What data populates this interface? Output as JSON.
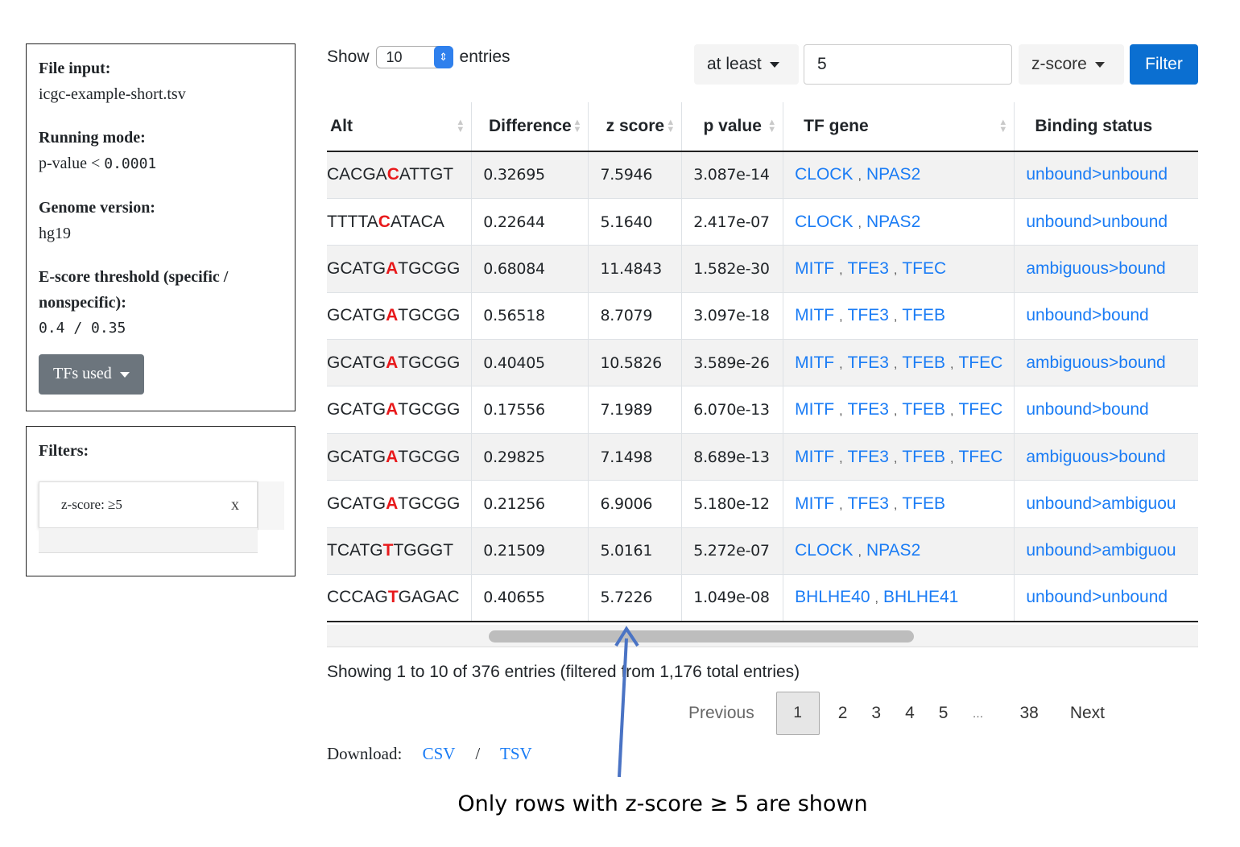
{
  "info": {
    "file_label": "File input:",
    "file_value": "icgc-example-short.tsv",
    "mode_label": "Running mode:",
    "mode_value_prefix": "p-value < ",
    "mode_value_num": "0.0001",
    "genome_label": "Genome version:",
    "genome_value": "hg19",
    "escore_label": "E-score threshold (specific / nonspecific):",
    "escore_value": "0.4 / 0.35",
    "tfs_button": "TFs used"
  },
  "filters": {
    "title": "Filters:",
    "chip_label": "z-score: ≥5",
    "chip_close": "x"
  },
  "controls": {
    "show_label": "Show",
    "entries_label": "entries",
    "length_value": "10",
    "comparator": "at least",
    "threshold_value": "5",
    "column": "z-score",
    "filter_button": "Filter"
  },
  "table": {
    "headers": [
      "Alt",
      "Difference",
      "z score",
      "p value",
      "TF gene",
      "Binding status"
    ],
    "rows": [
      {
        "alt_pre": "CACGA",
        "alt_mut": "C",
        "alt_post": "ATTGT",
        "diff": "0.32695",
        "z": "7.5946",
        "p": "3.087e-14",
        "genes": [
          "CLOCK",
          "NPAS2"
        ],
        "status": "unbound>unbound"
      },
      {
        "alt_pre": "TTTTA",
        "alt_mut": "C",
        "alt_post": "ATACA",
        "diff": "0.22644",
        "z": "5.1640",
        "p": "2.417e-07",
        "genes": [
          "CLOCK",
          "NPAS2"
        ],
        "status": "unbound>unbound"
      },
      {
        "alt_pre": "GCATG",
        "alt_mut": "A",
        "alt_post": "TGCGG",
        "diff": "0.68084",
        "z": "11.4843",
        "p": "1.582e-30",
        "genes": [
          "MITF",
          "TFE3",
          "TFEC"
        ],
        "status": "ambiguous>bound"
      },
      {
        "alt_pre": "GCATG",
        "alt_mut": "A",
        "alt_post": "TGCGG",
        "diff": "0.56518",
        "z": "8.7079",
        "p": "3.097e-18",
        "genes": [
          "MITF",
          "TFE3",
          "TFEB"
        ],
        "status": "unbound>bound"
      },
      {
        "alt_pre": "GCATG",
        "alt_mut": "A",
        "alt_post": "TGCGG",
        "diff": "0.40405",
        "z": "10.5826",
        "p": "3.589e-26",
        "genes": [
          "MITF",
          "TFE3",
          "TFEB",
          "TFEC"
        ],
        "status": "ambiguous>bound"
      },
      {
        "alt_pre": "GCATG",
        "alt_mut": "A",
        "alt_post": "TGCGG",
        "diff": "0.17556",
        "z": "7.1989",
        "p": "6.070e-13",
        "genes": [
          "MITF",
          "TFE3",
          "TFEB",
          "TFEC"
        ],
        "status": "unbound>bound"
      },
      {
        "alt_pre": "GCATG",
        "alt_mut": "A",
        "alt_post": "TGCGG",
        "diff": "0.29825",
        "z": "7.1498",
        "p": "8.689e-13",
        "genes": [
          "MITF",
          "TFE3",
          "TFEB",
          "TFEC"
        ],
        "status": "ambiguous>bound"
      },
      {
        "alt_pre": "GCATG",
        "alt_mut": "A",
        "alt_post": "TGCGG",
        "diff": "0.21256",
        "z": "6.9006",
        "p": "5.180e-12",
        "genes": [
          "MITF",
          "TFE3",
          "TFEB"
        ],
        "status": "unbound>ambiguou"
      },
      {
        "alt_pre": "TCATG",
        "alt_mut": "T",
        "alt_post": "TGGGT",
        "diff": "0.21509",
        "z": "5.0161",
        "p": "5.272e-07",
        "genes": [
          "CLOCK",
          "NPAS2"
        ],
        "status": "unbound>ambiguou"
      },
      {
        "alt_pre": "CCCAG",
        "alt_mut": "T",
        "alt_post": "GAGAC",
        "diff": "0.40655",
        "z": "5.7226",
        "p": "1.049e-08",
        "genes": [
          "BHLHE40",
          "BHLHE41"
        ],
        "status": "unbound>unbound"
      }
    ]
  },
  "summary": "Showing 1 to 10 of 376 entries (filtered from 1,176 total entries)",
  "pagination": {
    "previous": "Previous",
    "pages": [
      "1",
      "2",
      "3",
      "4",
      "5",
      "…",
      "38"
    ],
    "current": "1",
    "next": "Next"
  },
  "download": {
    "label": "Download:",
    "csv": "CSV",
    "slash": "/",
    "tsv": "TSV"
  },
  "annotation": "Only rows with z-score ≥ 5 are shown",
  "colors": {
    "link": "#1a7cf5",
    "mutation": "#e8191b",
    "filter_button": "#0b6fd1",
    "arrow": "#4a73c4"
  }
}
